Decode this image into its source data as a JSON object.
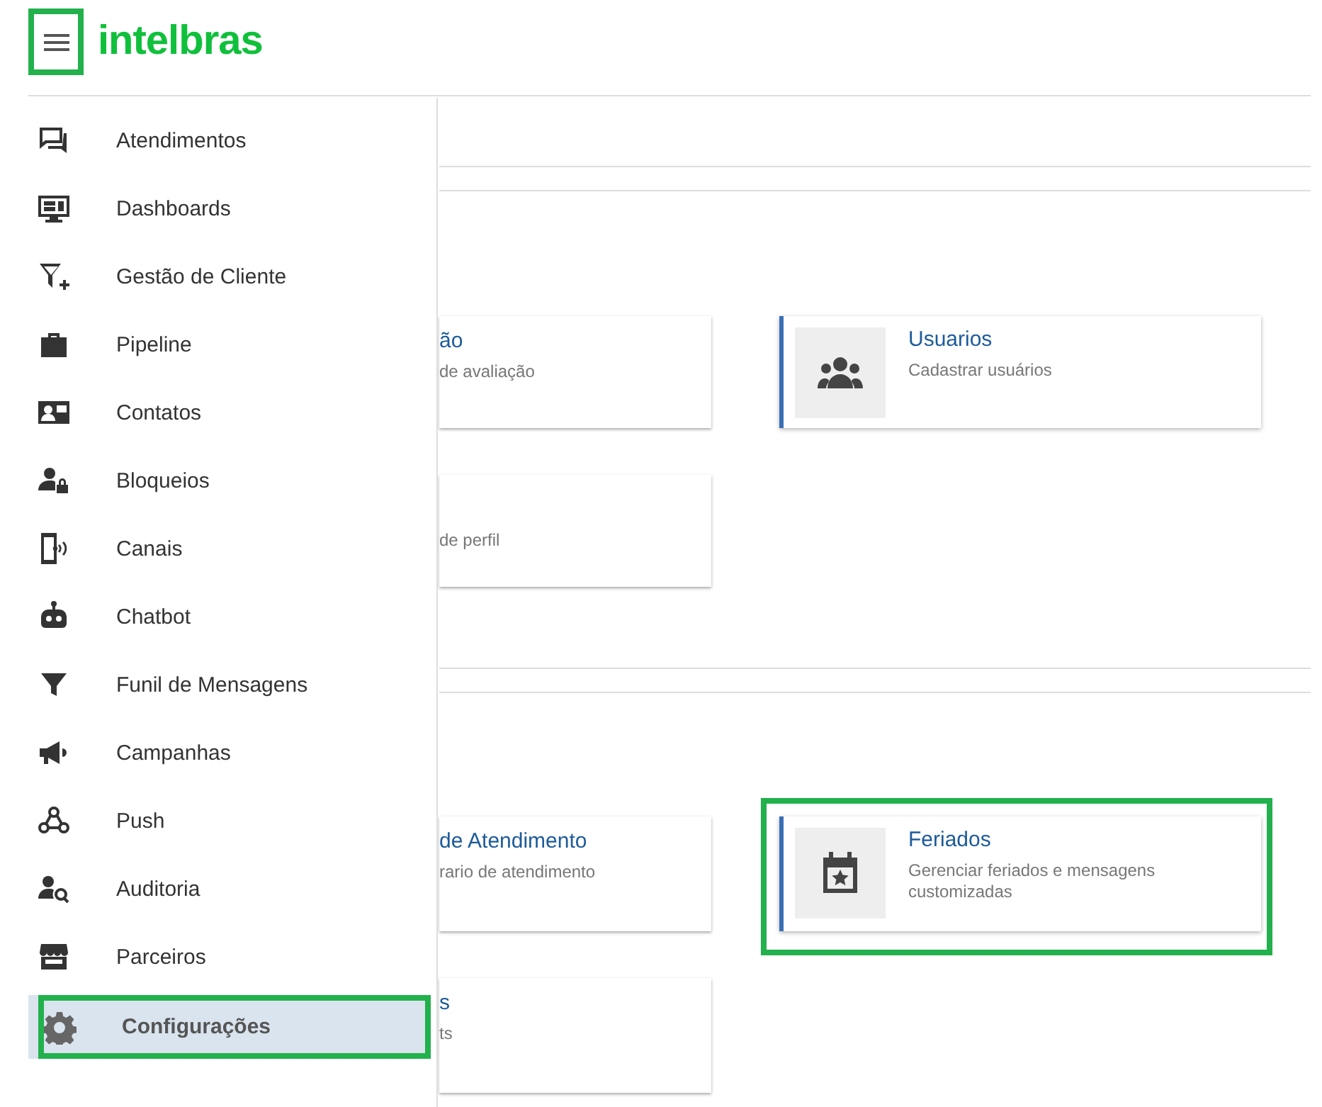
{
  "header": {
    "menu_button": {
      "highlighted": true
    },
    "logo": "intelbras"
  },
  "sidebar": {
    "items": [
      {
        "label": "Atendimentos",
        "selected": false,
        "highlighted": false
      },
      {
        "label": "Dashboards",
        "selected": false,
        "highlighted": false
      },
      {
        "label": "Gestão de Cliente",
        "selected": false,
        "highlighted": false
      },
      {
        "label": "Pipeline",
        "selected": false,
        "highlighted": false
      },
      {
        "label": "Contatos",
        "selected": false,
        "highlighted": false
      },
      {
        "label": "Bloqueios",
        "selected": false,
        "highlighted": false
      },
      {
        "label": "Canais",
        "selected": false,
        "highlighted": false
      },
      {
        "label": "Chatbot",
        "selected": false,
        "highlighted": false
      },
      {
        "label": "Funil de Mensagens",
        "selected": false,
        "highlighted": false
      },
      {
        "label": "Campanhas",
        "selected": false,
        "highlighted": false
      },
      {
        "label": "Push",
        "selected": false,
        "highlighted": false
      },
      {
        "label": "Auditoria",
        "selected": false,
        "highlighted": false
      },
      {
        "label": "Parceiros",
        "selected": false,
        "highlighted": false
      },
      {
        "label": "Configurações",
        "selected": true,
        "highlighted": true
      }
    ]
  },
  "sections": [
    {
      "rows": [
        {
          "left": {
            "title": "ão",
            "description": "de avaliação"
          },
          "right": {
            "title": "Usuarios",
            "description": "Cadastrar usuários",
            "highlighted": false
          }
        },
        {
          "left": {
            "description": "de perfil"
          }
        }
      ]
    },
    {
      "rows": [
        {
          "left": {
            "title": "de Atendimento",
            "description": "rario de atendimento"
          },
          "right": {
            "title": "Feriados",
            "description": "Gerenciar feriados e mensagens customizadas",
            "highlighted": true
          }
        },
        {
          "left": {
            "title": "s",
            "description": "ts"
          }
        }
      ]
    }
  ]
}
